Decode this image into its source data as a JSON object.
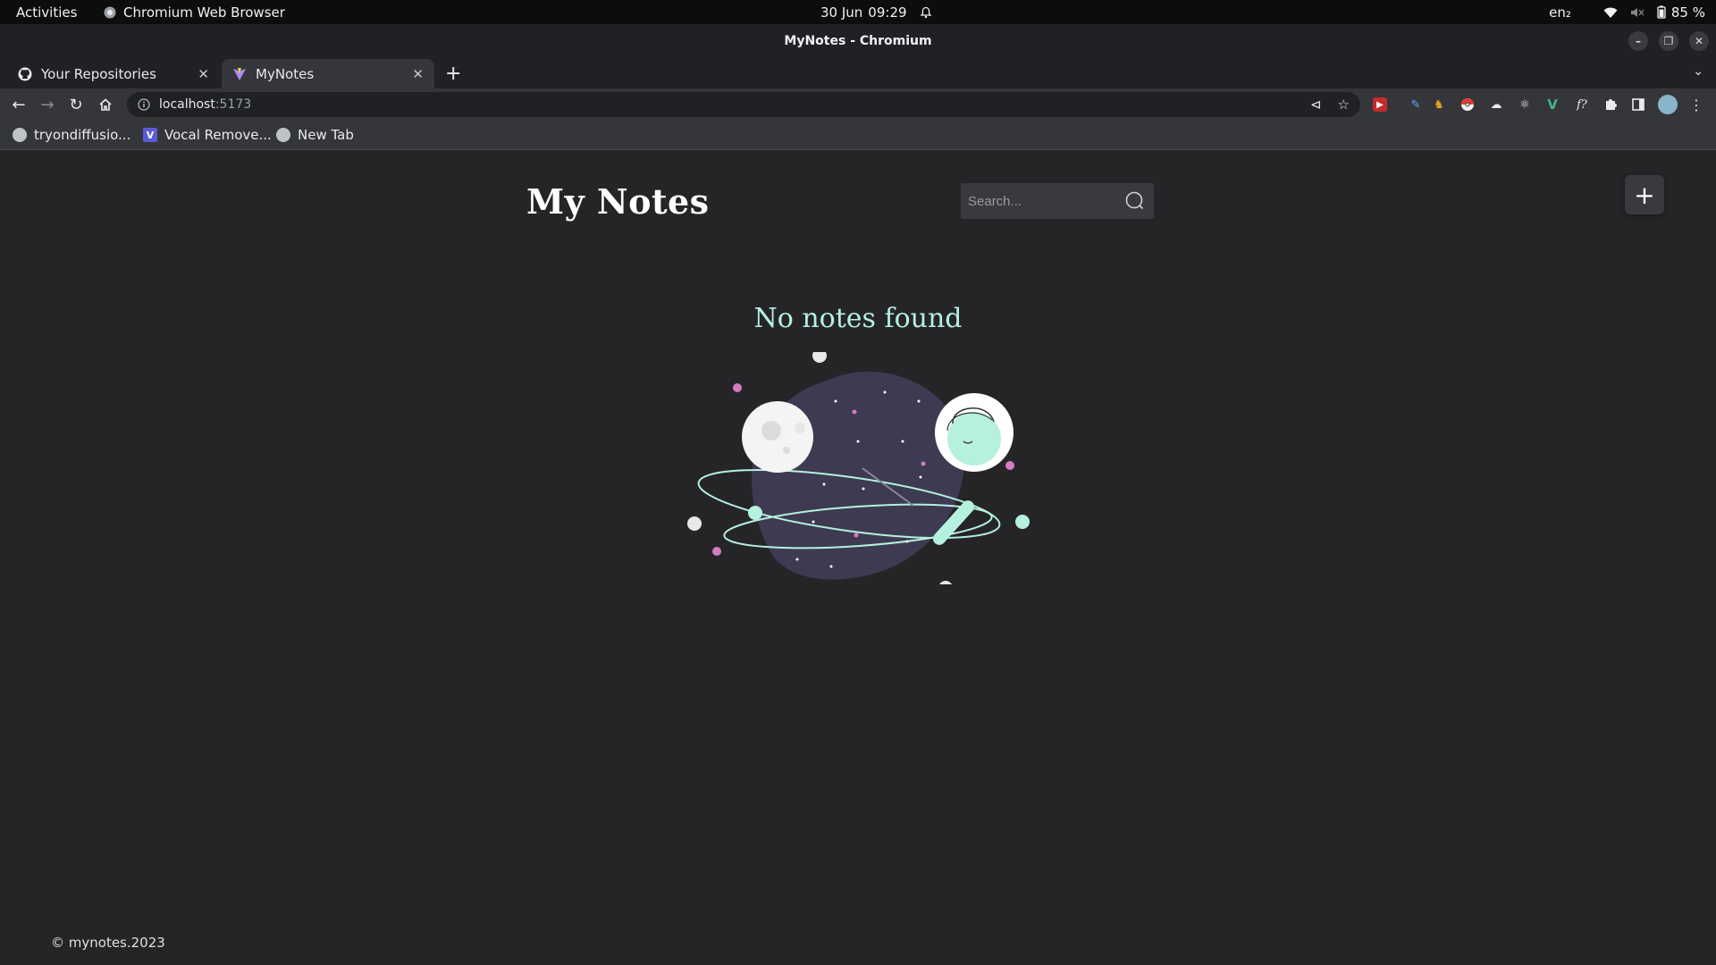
{
  "system_bar": {
    "activities": "Activities",
    "app_name": "Chromium Web Browser",
    "date": "30 Jun",
    "time": "09:29",
    "language": "en₂",
    "battery": "85 %"
  },
  "window": {
    "title": "MyNotes - Chromium"
  },
  "tabs": [
    {
      "label": "Your Repositories",
      "icon": "github-icon",
      "active": false
    },
    {
      "label": "MyNotes",
      "icon": "vite-icon",
      "active": true
    }
  ],
  "address_bar": {
    "host": "localhost",
    "port": ":5173"
  },
  "bookmarks": [
    {
      "label": "tryondiffusio...",
      "icon": "globe-icon"
    },
    {
      "label": "Vocal Remove...",
      "icon": "vocal-remover-icon"
    },
    {
      "label": "New Tab",
      "icon": "globe-icon"
    }
  ],
  "app": {
    "title": "My Notes",
    "search_placeholder": "Search...",
    "add_button_label": "+",
    "empty_message": "No notes found",
    "footer": "© mynotes.2023"
  },
  "colors": {
    "background": "#252528",
    "accent": "#b6f0de",
    "planet": "#3d3a52"
  }
}
